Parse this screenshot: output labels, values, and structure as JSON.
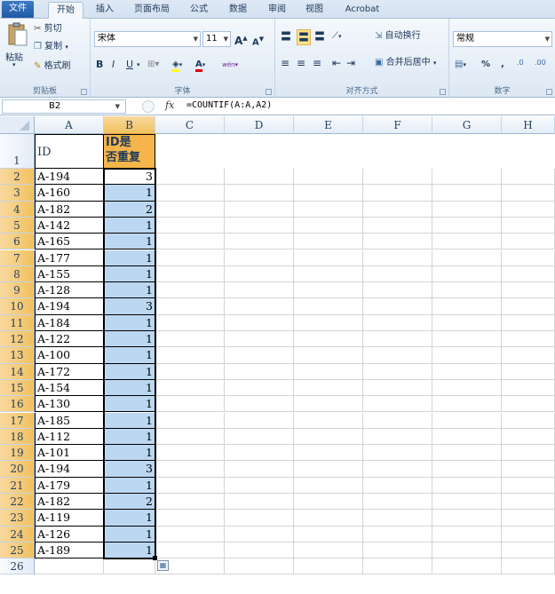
{
  "ribbon_tabs": [
    "文件",
    "开始",
    "插入",
    "页面布局",
    "公式",
    "数据",
    "审阅",
    "视图",
    "Acrobat"
  ],
  "clipboard": {
    "paste": "粘贴",
    "cut": "剪切",
    "copy": "复制",
    "format_painter": "格式刷",
    "label": "剪贴板"
  },
  "font": {
    "name": "宋体",
    "size": "11",
    "grow": "A",
    "shrink": "A",
    "bold": "B",
    "italic": "I",
    "underline": "U",
    "label": "字体",
    "phonetic": "wén"
  },
  "alignment": {
    "wrap": "自动换行",
    "merge": "合并后居中",
    "label": "对齐方式"
  },
  "number": {
    "format": "常规",
    "percent": "%",
    "comma": ",",
    "label": "数字",
    "inc_decimal": ".00",
    "dec_decimal": ".0"
  },
  "formula_bar": {
    "name_box": "B2",
    "fx": "fx",
    "formula": "=COUNTIF(A:A,A2)"
  },
  "columns": [
    "A",
    "B",
    "C",
    "D",
    "E",
    "F",
    "G",
    "H"
  ],
  "header_row": {
    "row": "1",
    "a": "ID",
    "b_line1": "ID是",
    "b_line2": "否重复"
  },
  "rows": [
    {
      "n": "2",
      "id": "A-194",
      "count": "3"
    },
    {
      "n": "3",
      "id": "A-160",
      "count": "1"
    },
    {
      "n": "4",
      "id": "A-182",
      "count": "2"
    },
    {
      "n": "5",
      "id": "A-142",
      "count": "1"
    },
    {
      "n": "6",
      "id": "A-165",
      "count": "1"
    },
    {
      "n": "7",
      "id": "A-177",
      "count": "1"
    },
    {
      "n": "8",
      "id": "A-155",
      "count": "1"
    },
    {
      "n": "9",
      "id": "A-128",
      "count": "1"
    },
    {
      "n": "10",
      "id": "A-194",
      "count": "3"
    },
    {
      "n": "11",
      "id": "A-184",
      "count": "1"
    },
    {
      "n": "12",
      "id": "A-122",
      "count": "1"
    },
    {
      "n": "13",
      "id": "A-100",
      "count": "1"
    },
    {
      "n": "14",
      "id": "A-172",
      "count": "1"
    },
    {
      "n": "15",
      "id": "A-154",
      "count": "1"
    },
    {
      "n": "16",
      "id": "A-130",
      "count": "1"
    },
    {
      "n": "17",
      "id": "A-185",
      "count": "1"
    },
    {
      "n": "18",
      "id": "A-112",
      "count": "1"
    },
    {
      "n": "19",
      "id": "A-101",
      "count": "1"
    },
    {
      "n": "20",
      "id": "A-194",
      "count": "3"
    },
    {
      "n": "21",
      "id": "A-179",
      "count": "1"
    },
    {
      "n": "22",
      "id": "A-182",
      "count": "2"
    },
    {
      "n": "23",
      "id": "A-119",
      "count": "1"
    },
    {
      "n": "24",
      "id": "A-126",
      "count": "1"
    },
    {
      "n": "25",
      "id": "A-189",
      "count": "1"
    }
  ],
  "last_row": "26",
  "colors": {
    "header_fill": "#f5b54a",
    "selection_fill": "#bcd7f2",
    "selected_header": "#f1c15f"
  }
}
